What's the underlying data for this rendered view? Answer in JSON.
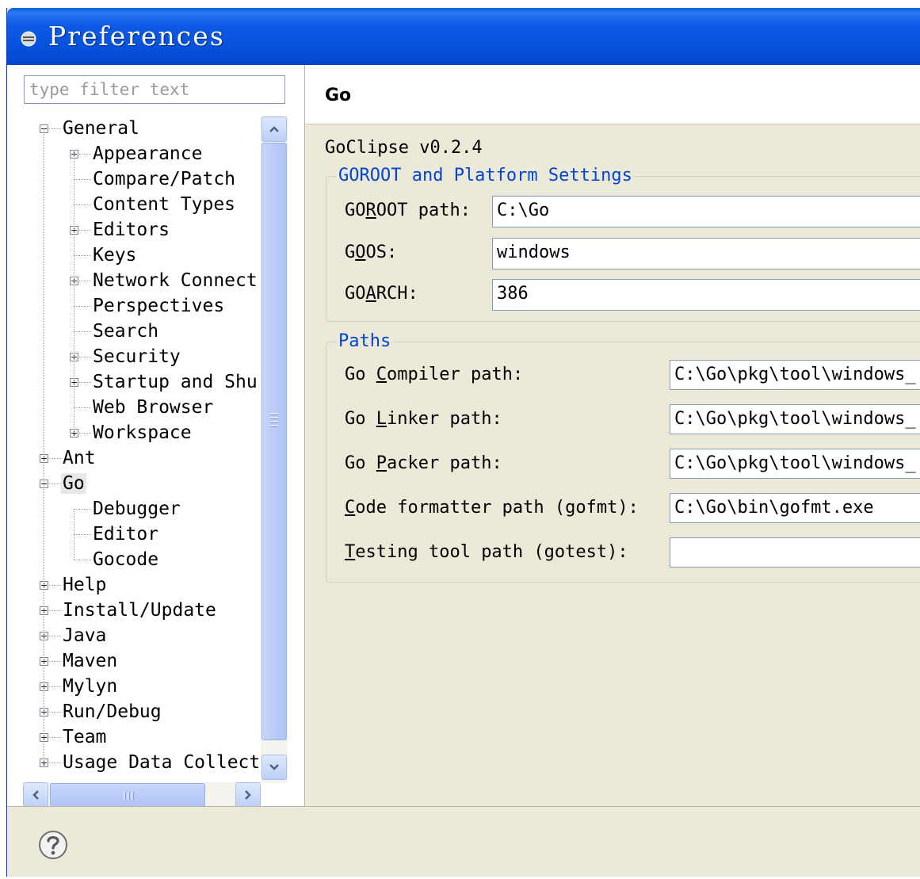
{
  "window": {
    "title": "Preferences"
  },
  "filter": {
    "placeholder": "type filter text"
  },
  "tree": [
    {
      "label": "General",
      "level": 0,
      "expander": "minus"
    },
    {
      "label": "Appearance",
      "level": 1,
      "expander": "plus"
    },
    {
      "label": "Compare/Patch",
      "level": 1,
      "expander": "none"
    },
    {
      "label": "Content Types",
      "level": 1,
      "expander": "none"
    },
    {
      "label": "Editors",
      "level": 1,
      "expander": "plus"
    },
    {
      "label": "Keys",
      "level": 1,
      "expander": "none"
    },
    {
      "label": "Network Connect",
      "level": 1,
      "expander": "plus"
    },
    {
      "label": "Perspectives",
      "level": 1,
      "expander": "none"
    },
    {
      "label": "Search",
      "level": 1,
      "expander": "none"
    },
    {
      "label": "Security",
      "level": 1,
      "expander": "plus"
    },
    {
      "label": "Startup and Shu",
      "level": 1,
      "expander": "plus"
    },
    {
      "label": "Web Browser",
      "level": 1,
      "expander": "none"
    },
    {
      "label": "Workspace",
      "level": 1,
      "expander": "plus"
    },
    {
      "label": "Ant",
      "level": 0,
      "expander": "plus"
    },
    {
      "label": "Go",
      "level": 0,
      "expander": "minus",
      "selected": true
    },
    {
      "label": "Debugger",
      "level": 1,
      "expander": "none"
    },
    {
      "label": "Editor",
      "level": 1,
      "expander": "none"
    },
    {
      "label": "Gocode",
      "level": 1,
      "expander": "none"
    },
    {
      "label": "Help",
      "level": 0,
      "expander": "plus"
    },
    {
      "label": "Install/Update",
      "level": 0,
      "expander": "plus"
    },
    {
      "label": "Java",
      "level": 0,
      "expander": "plus"
    },
    {
      "label": "Maven",
      "level": 0,
      "expander": "plus"
    },
    {
      "label": "Mylyn",
      "level": 0,
      "expander": "plus"
    },
    {
      "label": "Run/Debug",
      "level": 0,
      "expander": "plus"
    },
    {
      "label": "Team",
      "level": 0,
      "expander": "plus"
    },
    {
      "label": "Usage Data Collect",
      "level": 0,
      "expander": "plus"
    }
  ],
  "page": {
    "title": "Go",
    "version": "GoClipse v0.2.4",
    "goroot_group": {
      "title": "GOROOT and Platform Settings",
      "fields": [
        {
          "pre": "GO",
          "mn": "R",
          "post": "OOT path:",
          "value": "C:\\Go"
        },
        {
          "pre": "G",
          "mn": "O",
          "post": "OS:",
          "value": "windows"
        },
        {
          "pre": "GO",
          "mn": "A",
          "post": "RCH:",
          "value": "386"
        }
      ]
    },
    "paths_group": {
      "title": "Paths",
      "fields": [
        {
          "pre": "Go ",
          "mn": "C",
          "post": "ompiler path:",
          "value": "C:\\Go\\pkg\\tool\\windows_"
        },
        {
          "pre": "Go ",
          "mn": "L",
          "post": "inker path:",
          "value": "C:\\Go\\pkg\\tool\\windows_"
        },
        {
          "pre": "Go ",
          "mn": "P",
          "post": "acker path:",
          "value": "C:\\Go\\pkg\\tool\\windows_"
        },
        {
          "pre": "",
          "mn": "C",
          "post": "ode formatter path (gofmt):",
          "value": "C:\\Go\\bin\\gofmt.exe"
        },
        {
          "pre": "",
          "mn": "T",
          "post": "esting tool path (gotest):",
          "value": ""
        }
      ]
    }
  },
  "icons": {
    "title_icon": "preferences-icon",
    "help_icon": "help-icon",
    "scroll_up": "arrow-up-icon",
    "scroll_down": "arrow-down-icon",
    "scroll_left": "arrow-left-icon",
    "scroll_right": "arrow-right-icon"
  },
  "colors": {
    "titlebar": "#0551dc",
    "group_title": "#0046d5",
    "dialog_bg": "#ece9d8"
  }
}
